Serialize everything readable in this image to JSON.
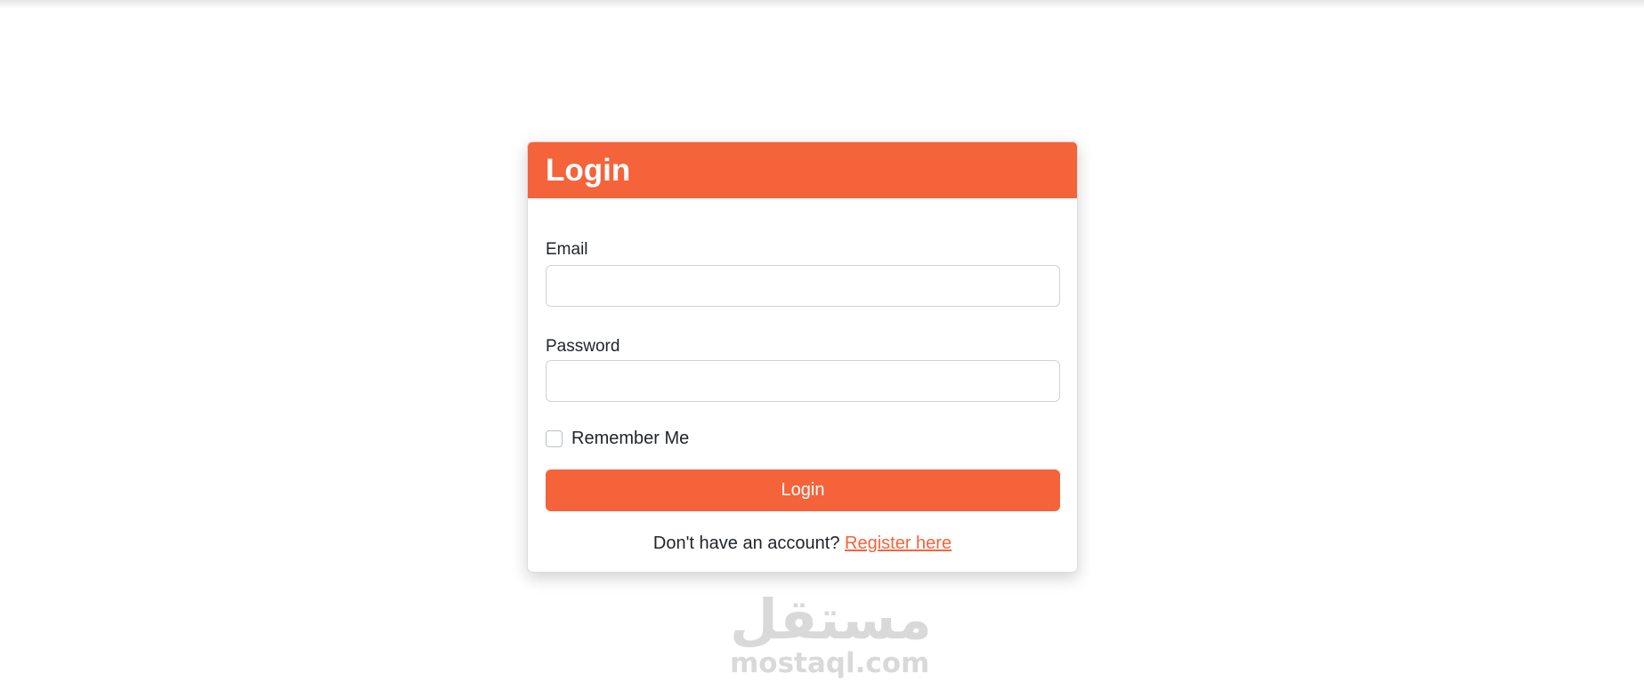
{
  "theme": {
    "accent": "#f5633a"
  },
  "login_card": {
    "title": "Login",
    "email_label": "Email",
    "email_value": "",
    "password_label": "Password",
    "password_value": "",
    "remember_label": "Remember Me",
    "remember_checked": false,
    "submit_label": "Login",
    "register_prompt": "Don't have an account?",
    "register_link": "Register here"
  },
  "watermark": {
    "arabic": "مستقل",
    "domain": "mostaql.com"
  }
}
